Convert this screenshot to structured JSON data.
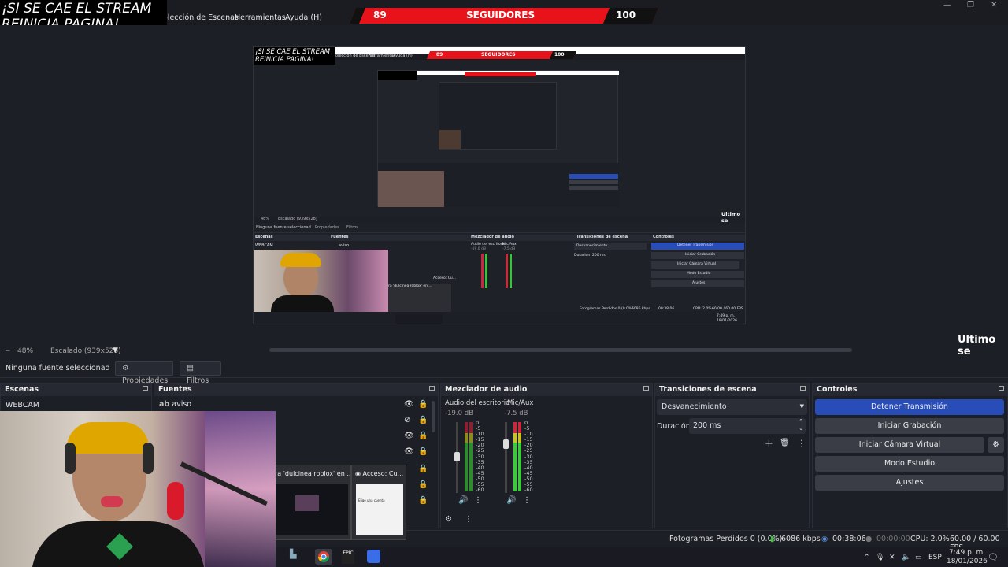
{
  "overlay": {
    "line1": "¡SI SE CAE EL STREAM",
    "line2": "REINICIA PAGINA!"
  },
  "menubar": {
    "items": [
      "olección de Escenas",
      "Herramientas",
      "Ayuda (H)"
    ]
  },
  "followers": {
    "current": "89",
    "label": "SEGUIDORES",
    "goal": "100",
    "accent": "#e8121a"
  },
  "ticker": "Ultimo se",
  "zoom": {
    "minus": "−",
    "value": "48%",
    "scaling": "Escalado (939x528)"
  },
  "source_toolbar": {
    "selected": "Ninguna fuente seleccionad",
    "properties": "Propiedades",
    "filters": "Filtros"
  },
  "scenes": {
    "title": "Escenas",
    "items": [
      "WEBCAM"
    ]
  },
  "sources": {
    "title": "Fuentes",
    "items": [
      "aviso"
    ]
  },
  "mixer": {
    "title": "Mezclador de audio",
    "channels": [
      {
        "name": "Audio del escritoric",
        "db": "-19.0 dB"
      },
      {
        "name": "Mic/Aux",
        "db": "-7.5 dB"
      }
    ],
    "scale": [
      "0",
      "-5",
      "-10",
      "-15",
      "-20",
      "-25",
      "-30",
      "-35",
      "-40",
      "-45",
      "-50",
      "-55",
      "-60"
    ]
  },
  "transitions": {
    "title": "Transiciones de escena",
    "selected": "Desvanecimiento",
    "duration_label": "Duración",
    "duration_value": "200 ms"
  },
  "controls": {
    "title": "Controles",
    "stop_stream": "Detener Transmisión",
    "start_rec": "Iniciar Grabación",
    "virtual_cam": "Iniciar Cámara Virtual",
    "studio": "Modo Estudio",
    "settings": "Ajustes",
    "accent": "#284cb8"
  },
  "status": {
    "dropped": "Fotogramas Perdidos 0 (0.0%)",
    "bitrate": "6086 kbps",
    "stream_time": "00:38:06",
    "rec_time": "00:00:00",
    "cpu": "CPU: 2.0%",
    "fps": "60.00 / 60.00 FPS"
  },
  "taskbar_popups": [
    {
      "title": "ra 'dulcinea roblox' en ..."
    },
    {
      "title": "Acceso: Cu..."
    }
  ],
  "popup_inner": "Elige una cuenta",
  "tray": {
    "lang": "ESP",
    "time": "7:49 p. m.",
    "date": "18/01/2026"
  },
  "nested": {
    "dropped": "Fotogramas Perdidos 0 (0.0%)",
    "bitrate": "6086 kbps",
    "time": "00:38:06",
    "cpu": "CPU: 2.0%",
    "fps": "60.00 / 60.00 FPS",
    "clock": "7:49 p. m.",
    "date": "18/01/2026",
    "zoom": "48%",
    "scaling": "Escalado (939x528)",
    "no_source": "Ninguna fuente seleccionad",
    "props": "Propiedades",
    "filters": "Filtros",
    "docks": [
      "Escenas",
      "Fuentes",
      "Mezclador de audio",
      "Transiciones de escena",
      "Controles"
    ],
    "scene": "WEBCAM",
    "source": "aviso",
    "mix1": "Audio del escritorio",
    "mix2": "Mic/Aux",
    "db1": "-19.0 dB",
    "db2": "-7.5 dB",
    "trans": "Desvanecimiento",
    "dur": "Duración",
    "durval": "200 ms",
    "ctl": [
      "Detener Transmisión",
      "Iniciar Grabación",
      "Iniciar Cámara Virtual",
      "Modo Estudio",
      "Ajustes"
    ],
    "popup1": "ra 'dulcinea roblox' en ...",
    "popup2": "Acceso: Cu...",
    "menu": [
      "olección de Escenas",
      "Herramientas",
      "Ayuda (H)"
    ]
  }
}
